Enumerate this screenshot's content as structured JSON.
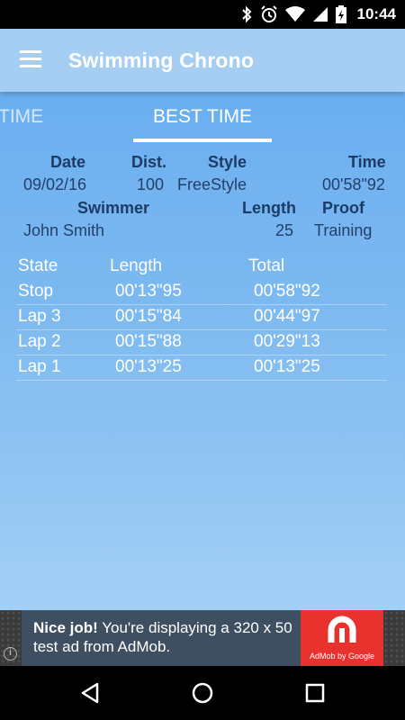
{
  "status_bar": {
    "time": "10:44",
    "icons": [
      "bluetooth-icon",
      "alarm-icon",
      "wifi-icon",
      "signal-icon",
      "battery-icon"
    ]
  },
  "app_bar": {
    "title": "Swimming Chrono",
    "menu_icon": "hamburger-menu-icon"
  },
  "tabs": [
    {
      "label": "TIME",
      "selected": false
    },
    {
      "label": "BEST TIME",
      "selected": true
    }
  ],
  "info": {
    "headers": {
      "date": "Date",
      "dist": "Dist.",
      "style": "Style",
      "time": "Time"
    },
    "values": {
      "date": "09/02/16",
      "dist": "100",
      "style": "FreeStyle",
      "time": "00'58\"92"
    },
    "headers2": {
      "swimmer": "Swimmer",
      "length": "Length",
      "proof": "Proof"
    },
    "values2": {
      "swimmer": "John Smith",
      "length": "25",
      "proof": "Training"
    }
  },
  "laps": {
    "headers": {
      "state": "State",
      "length": "Length",
      "total": "Total"
    },
    "rows": [
      {
        "state": "Stop",
        "length": "00'13\"95",
        "total": "00'58\"92"
      },
      {
        "state": "Lap 3",
        "length": "00'15\"84",
        "total": "00'44\"97"
      },
      {
        "state": "Lap 2",
        "length": "00'15\"88",
        "total": "00'29\"13"
      },
      {
        "state": "Lap 1",
        "length": "00'13\"25",
        "total": "00'13\"25"
      }
    ]
  },
  "ad": {
    "headline": "Nice job!",
    "body": " You're displaying a 320 x 50 test ad from AdMob.",
    "logo_text": "AdMob by Google",
    "info_glyph": "i"
  },
  "colors": {
    "app_bar": "#a6cef3",
    "content_top": "#6aaef0",
    "header_text": "#1d3b66",
    "ad_logo": "#e8322d"
  }
}
